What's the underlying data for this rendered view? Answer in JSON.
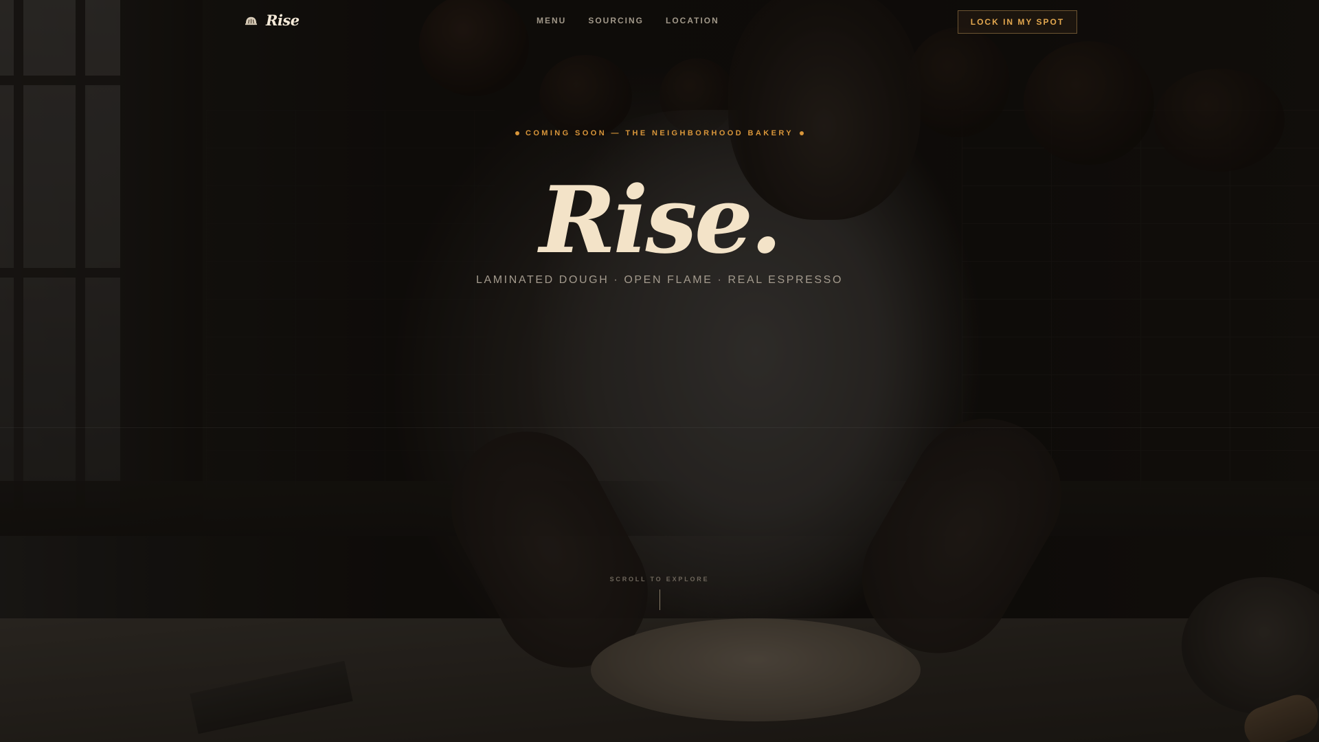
{
  "nav": {
    "logo_text": "Rise",
    "logo_icon": "bread-dome-icon",
    "links": [
      "MENU",
      "SOURCING",
      "LOCATION"
    ],
    "cta_label": "LOCK IN MY SPOT"
  },
  "hero": {
    "eyebrow": "COMING SOON — THE NEIGHBORHOOD BAKERY",
    "title": "Rise.",
    "subtitle": "LAMINATED DOUGH · OPEN FLAME · REAL ESPRESSO"
  },
  "scroll": {
    "label": "SCROLL TO EXPLORE"
  },
  "colors": {
    "accent": "#d9963a",
    "title": "#f3e3c8",
    "background": "#0d0a08"
  }
}
